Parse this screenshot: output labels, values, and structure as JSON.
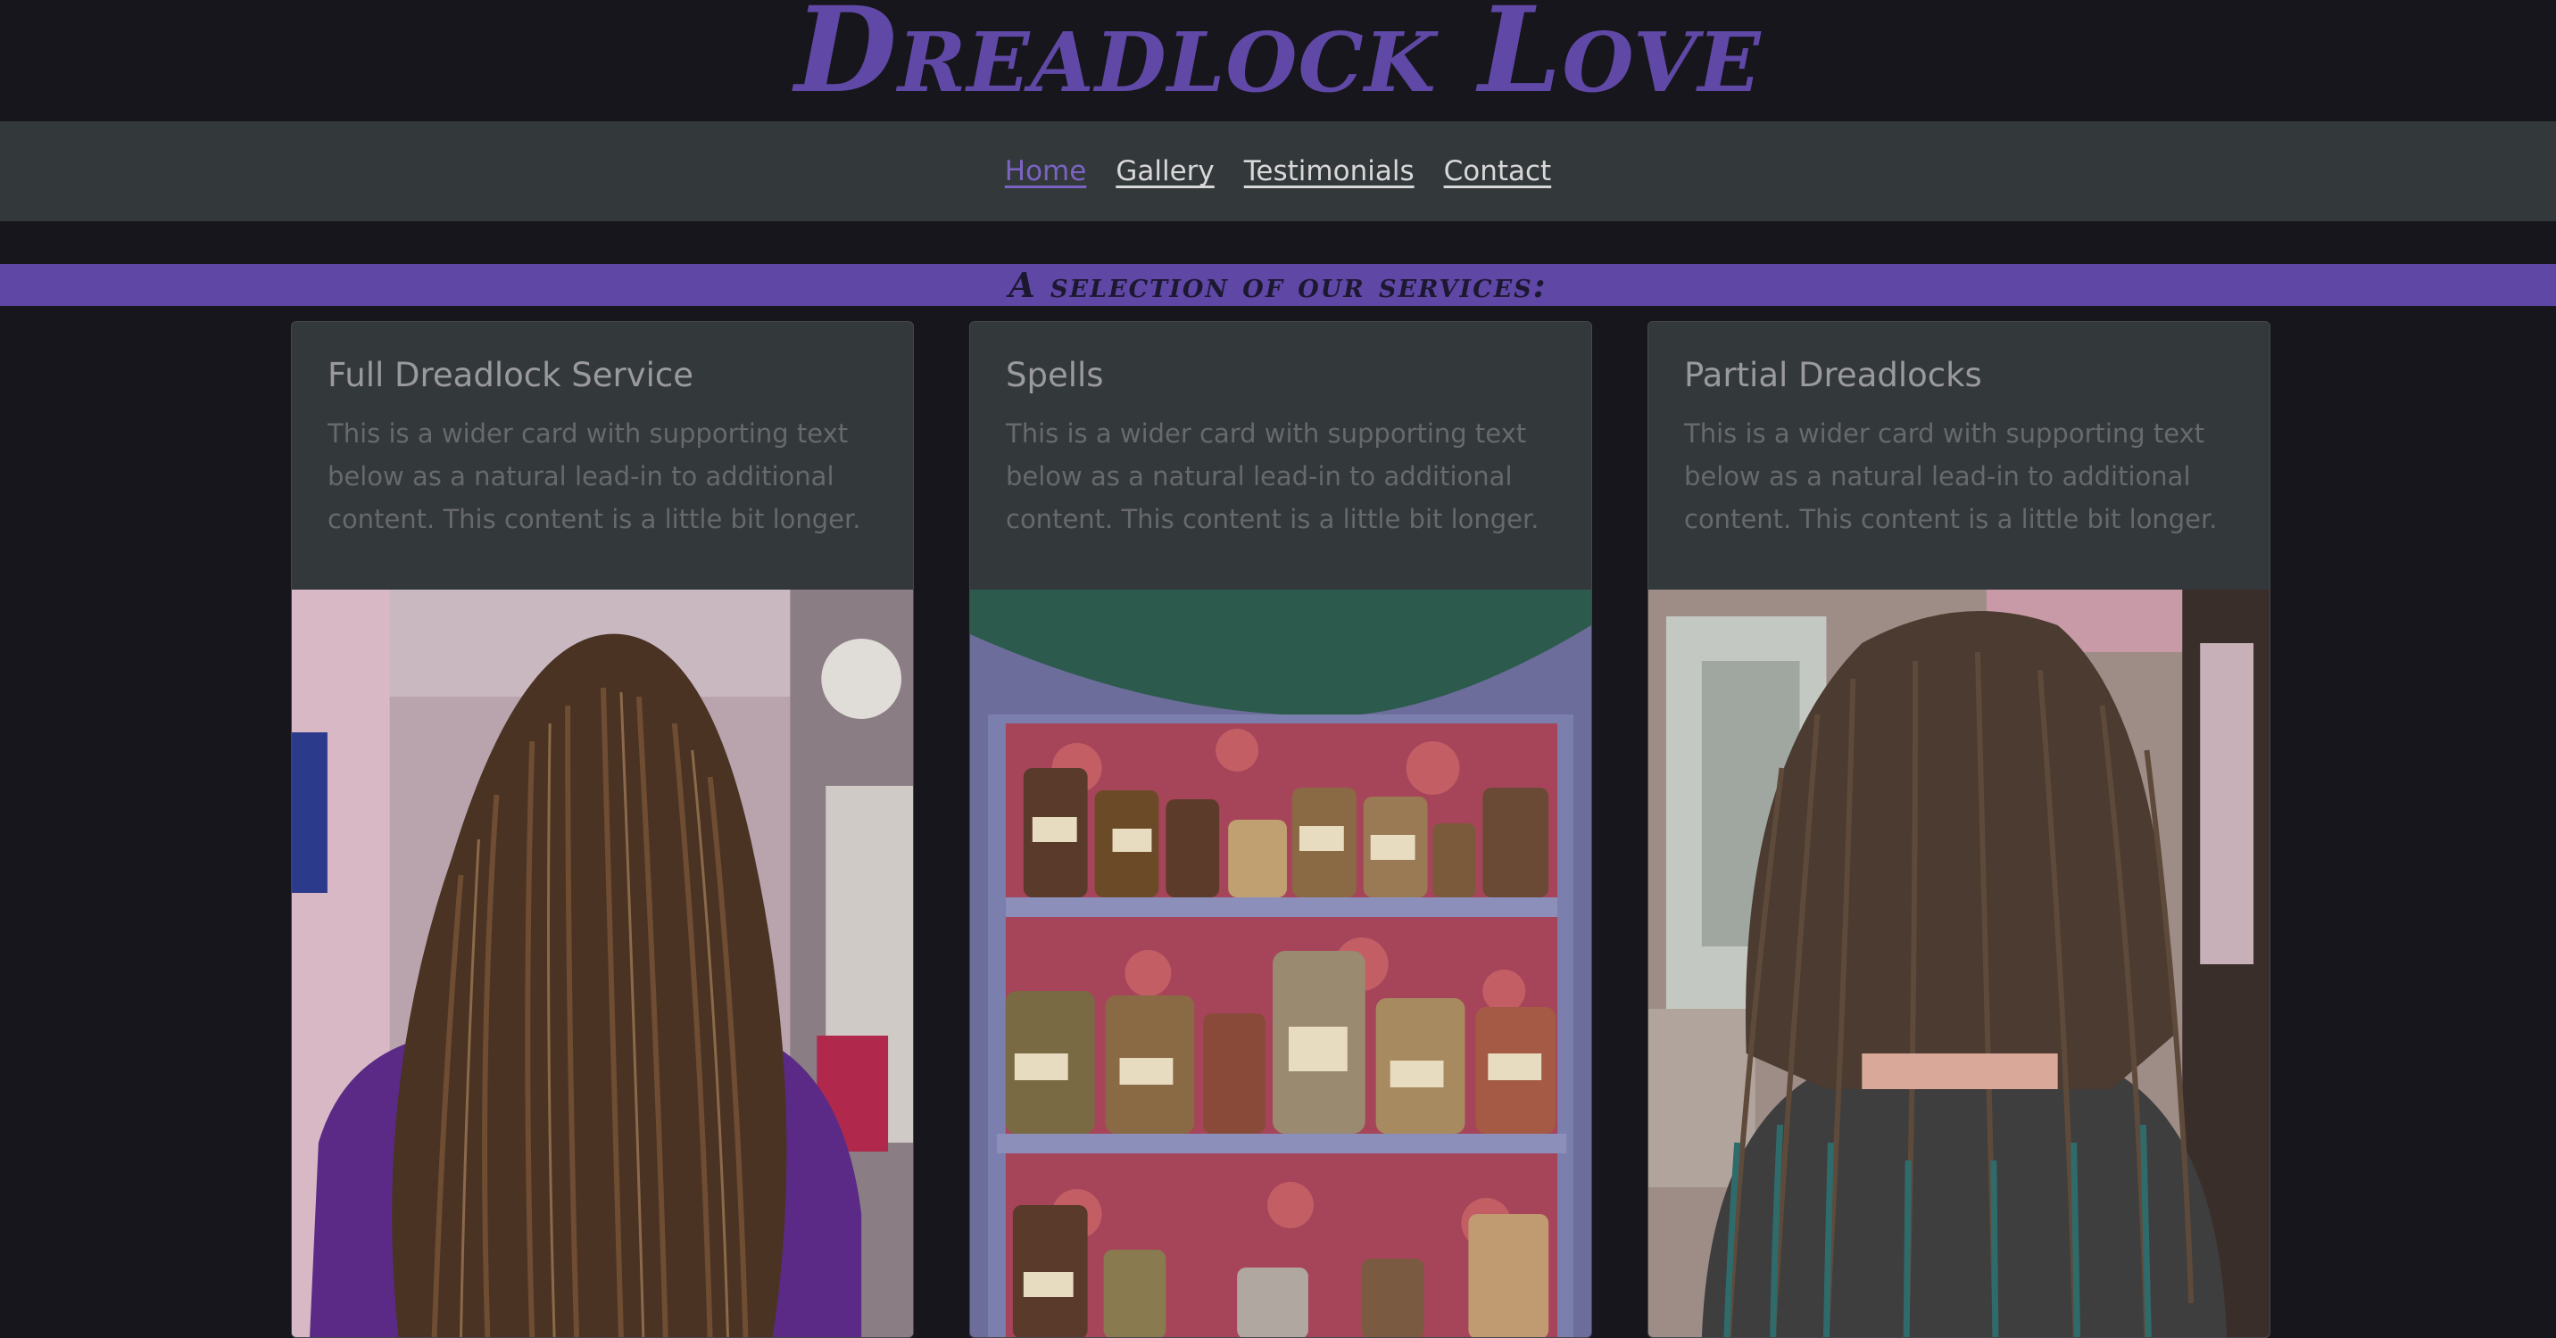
{
  "site": {
    "title": "Dreadlock Love"
  },
  "nav": {
    "items": [
      {
        "label": "Home",
        "active": true
      },
      {
        "label": "Gallery",
        "active": false
      },
      {
        "label": "Testimonials",
        "active": false
      },
      {
        "label": "Contact",
        "active": false
      }
    ]
  },
  "services": {
    "heading": "A selection of our services:",
    "cards": [
      {
        "title": "Full Dreadlock Service",
        "text": "This is a wider card with supporting text below as a natural lead-in to additional content. This content is a little bit longer."
      },
      {
        "title": "Spells",
        "text": "This is a wider card with supporting text below as a natural lead-in to additional content. This content is a little bit longer."
      },
      {
        "title": "Partial Dreadlocks",
        "text": "This is a wider card with supporting text below as a natural lead-in to additional content. This content is a little bit longer."
      }
    ]
  },
  "colors": {
    "background": "#17161c",
    "brand_purple": "#6048a6",
    "navbar": "#33383b",
    "card": "#33383b",
    "active_link": "#7b63c2"
  }
}
